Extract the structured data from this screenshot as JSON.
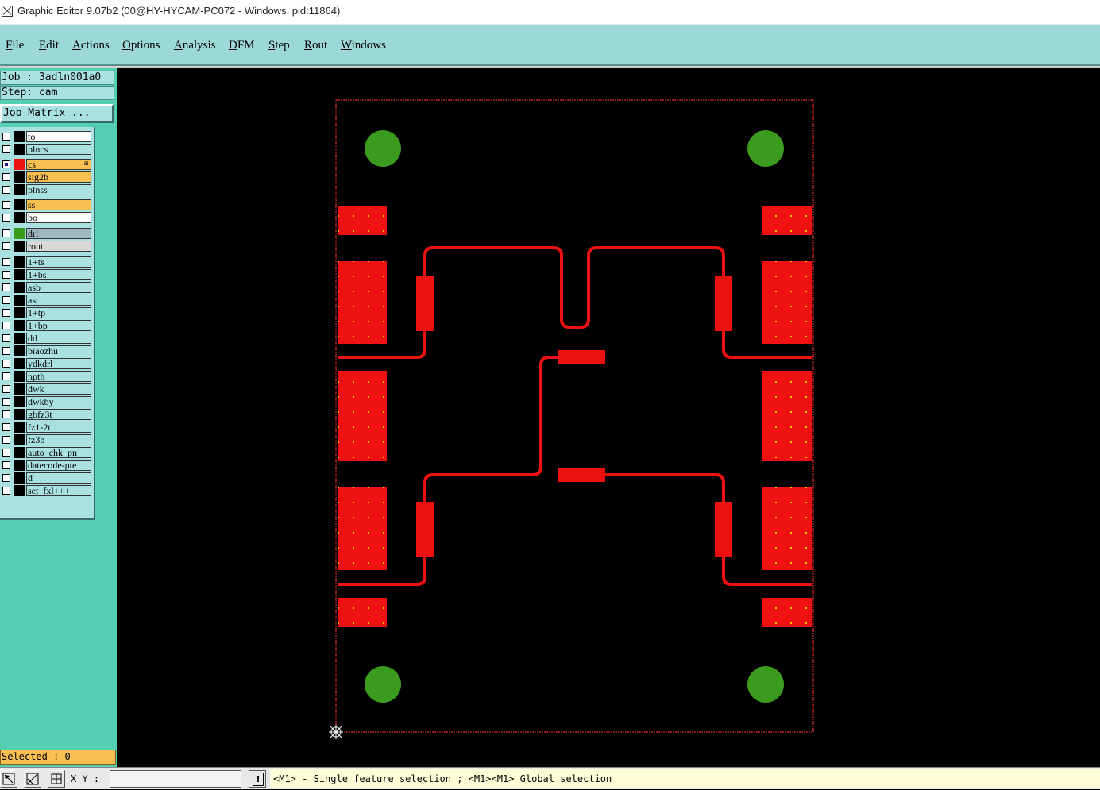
{
  "window": {
    "title": "Graphic Editor 9.07b2 (00@HY-HYCAM-PC072 - Windows, pid:11864)",
    "icon": "graphic-editor-app-icon"
  },
  "menu": [
    "File",
    "Edit",
    "Actions",
    "Options",
    "Analysis",
    "DFM",
    "Step",
    "Rout",
    "Windows"
  ],
  "panel": {
    "job": "Job : 3adln001a0",
    "step": "Step: cam",
    "job_matrix": "Job Matrix ...",
    "selected": "Selected : 0"
  },
  "layers": [
    {
      "name": "to",
      "color": "#ffffff",
      "swatch": "#000000",
      "checked": false
    },
    {
      "name": "plncs",
      "color": "#a9e1e1",
      "swatch": "#000000",
      "checked": false
    },
    {
      "name": "cs",
      "color": "#f8c050",
      "swatch": "#ee1111",
      "checked": true,
      "work": true
    },
    {
      "name": "sig2b",
      "color": "#f8c050",
      "swatch": "#000000",
      "checked": false
    },
    {
      "name": "plnss",
      "color": "#a9e1e1",
      "swatch": "#000000",
      "checked": false
    },
    {
      "name": "ss",
      "color": "#f8c050",
      "swatch": "#000000",
      "checked": false
    },
    {
      "name": "bo",
      "color": "#ffffff",
      "swatch": "#000000",
      "checked": false
    },
    {
      "name": "drl",
      "color": "#9fb8c0",
      "swatch": "#3b9b1f",
      "checked": false
    },
    {
      "name": "rout",
      "color": "#d8d8d8",
      "swatch": "#000000",
      "checked": false
    },
    {
      "name": "1+ts",
      "color": "#a9e1e1",
      "swatch": "#000000",
      "checked": false
    },
    {
      "name": "1+bs",
      "color": "#a9e1e1",
      "swatch": "#000000",
      "checked": false
    },
    {
      "name": "asb",
      "color": "#a9e1e1",
      "swatch": "#000000",
      "checked": false
    },
    {
      "name": "ast",
      "color": "#a9e1e1",
      "swatch": "#000000",
      "checked": false
    },
    {
      "name": "1+tp",
      "color": "#a9e1e1",
      "swatch": "#000000",
      "checked": false
    },
    {
      "name": "1+bp",
      "color": "#a9e1e1",
      "swatch": "#000000",
      "checked": false
    },
    {
      "name": "dd",
      "color": "#a9e1e1",
      "swatch": "#000000",
      "checked": false
    },
    {
      "name": "biaozhu",
      "color": "#a9e1e1",
      "swatch": "#000000",
      "checked": false
    },
    {
      "name": "ydkdrl",
      "color": "#a9e1e1",
      "swatch": "#000000",
      "checked": false
    },
    {
      "name": "npth",
      "color": "#a9e1e1",
      "swatch": "#000000",
      "checked": false
    },
    {
      "name": "dwk",
      "color": "#a9e1e1",
      "swatch": "#000000",
      "checked": false
    },
    {
      "name": "dwkby",
      "color": "#a9e1e1",
      "swatch": "#000000",
      "checked": false
    },
    {
      "name": "gbfz3t",
      "color": "#a9e1e1",
      "swatch": "#000000",
      "checked": false
    },
    {
      "name": "fz1-2t",
      "color": "#a9e1e1",
      "swatch": "#000000",
      "checked": false
    },
    {
      "name": "fz3b",
      "color": "#a9e1e1",
      "swatch": "#000000",
      "checked": false
    },
    {
      "name": "auto_chk_pn",
      "color": "#a9e1e1",
      "swatch": "#000000",
      "checked": false
    },
    {
      "name": "datecode-pte",
      "color": "#a9e1e1",
      "swatch": "#000000",
      "checked": false
    },
    {
      "name": "d",
      "color": "#a9e1e1",
      "swatch": "#000000",
      "checked": false
    },
    {
      "name": "set_fxl+++",
      "color": "#a9e1e1",
      "swatch": "#000000",
      "checked": false
    }
  ],
  "colors": {
    "canvas": "#000000",
    "copper": "#ee1111",
    "drill": "#3b9b1f",
    "profile": "#ff3333",
    "pad_dot": "#ffcc00"
  },
  "statusbar": {
    "xy_label": "X Y :",
    "xy_value": "",
    "message": "<M1> - Single feature selection ; <M1><M1> Global selection",
    "icons": [
      "select-arrow-icon",
      "zoom-pan-icon",
      "snap-grid-icon",
      "warning-icon"
    ]
  }
}
